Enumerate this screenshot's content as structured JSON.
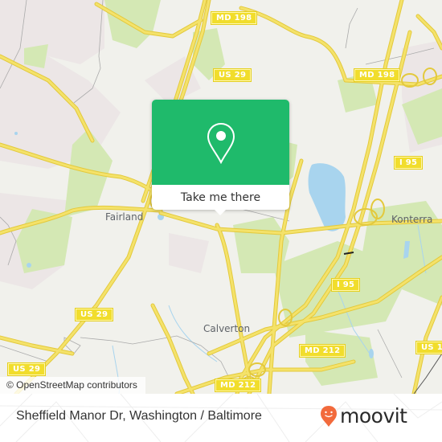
{
  "map": {
    "colors": {
      "background": "#f1f1ec",
      "park": "#d4e8b4",
      "residential": "#ece6e6",
      "water": "#a8d4ee",
      "major_road": "#f4e26a",
      "road_casing": "#e3c93c",
      "minor_road": "#aaaaaa"
    },
    "shields": [
      {
        "label": "MD 198"
      },
      {
        "label": "US 29"
      },
      {
        "label": "MD 198"
      },
      {
        "label": "I 95"
      },
      {
        "label": "I 95"
      },
      {
        "label": "US 29"
      },
      {
        "label": "US 29"
      },
      {
        "label": "MD 212"
      },
      {
        "label": "MD 212"
      },
      {
        "label": "US 1"
      }
    ],
    "places": [
      {
        "label": "Fairland"
      },
      {
        "label": "Konterra"
      },
      {
        "label": "Calverton"
      }
    ],
    "attribution": "© OpenStreetMap contributors"
  },
  "popup": {
    "action_label": "Take me there",
    "accent_color": "#1fba6b",
    "icon": "map-pin-icon"
  },
  "footer": {
    "title": "Sheffield Manor Dr, Washington / Baltimore",
    "brand": "moovit",
    "brand_color": "#f26a3c",
    "logo_icon": "moovit-smiley-pin-icon"
  }
}
